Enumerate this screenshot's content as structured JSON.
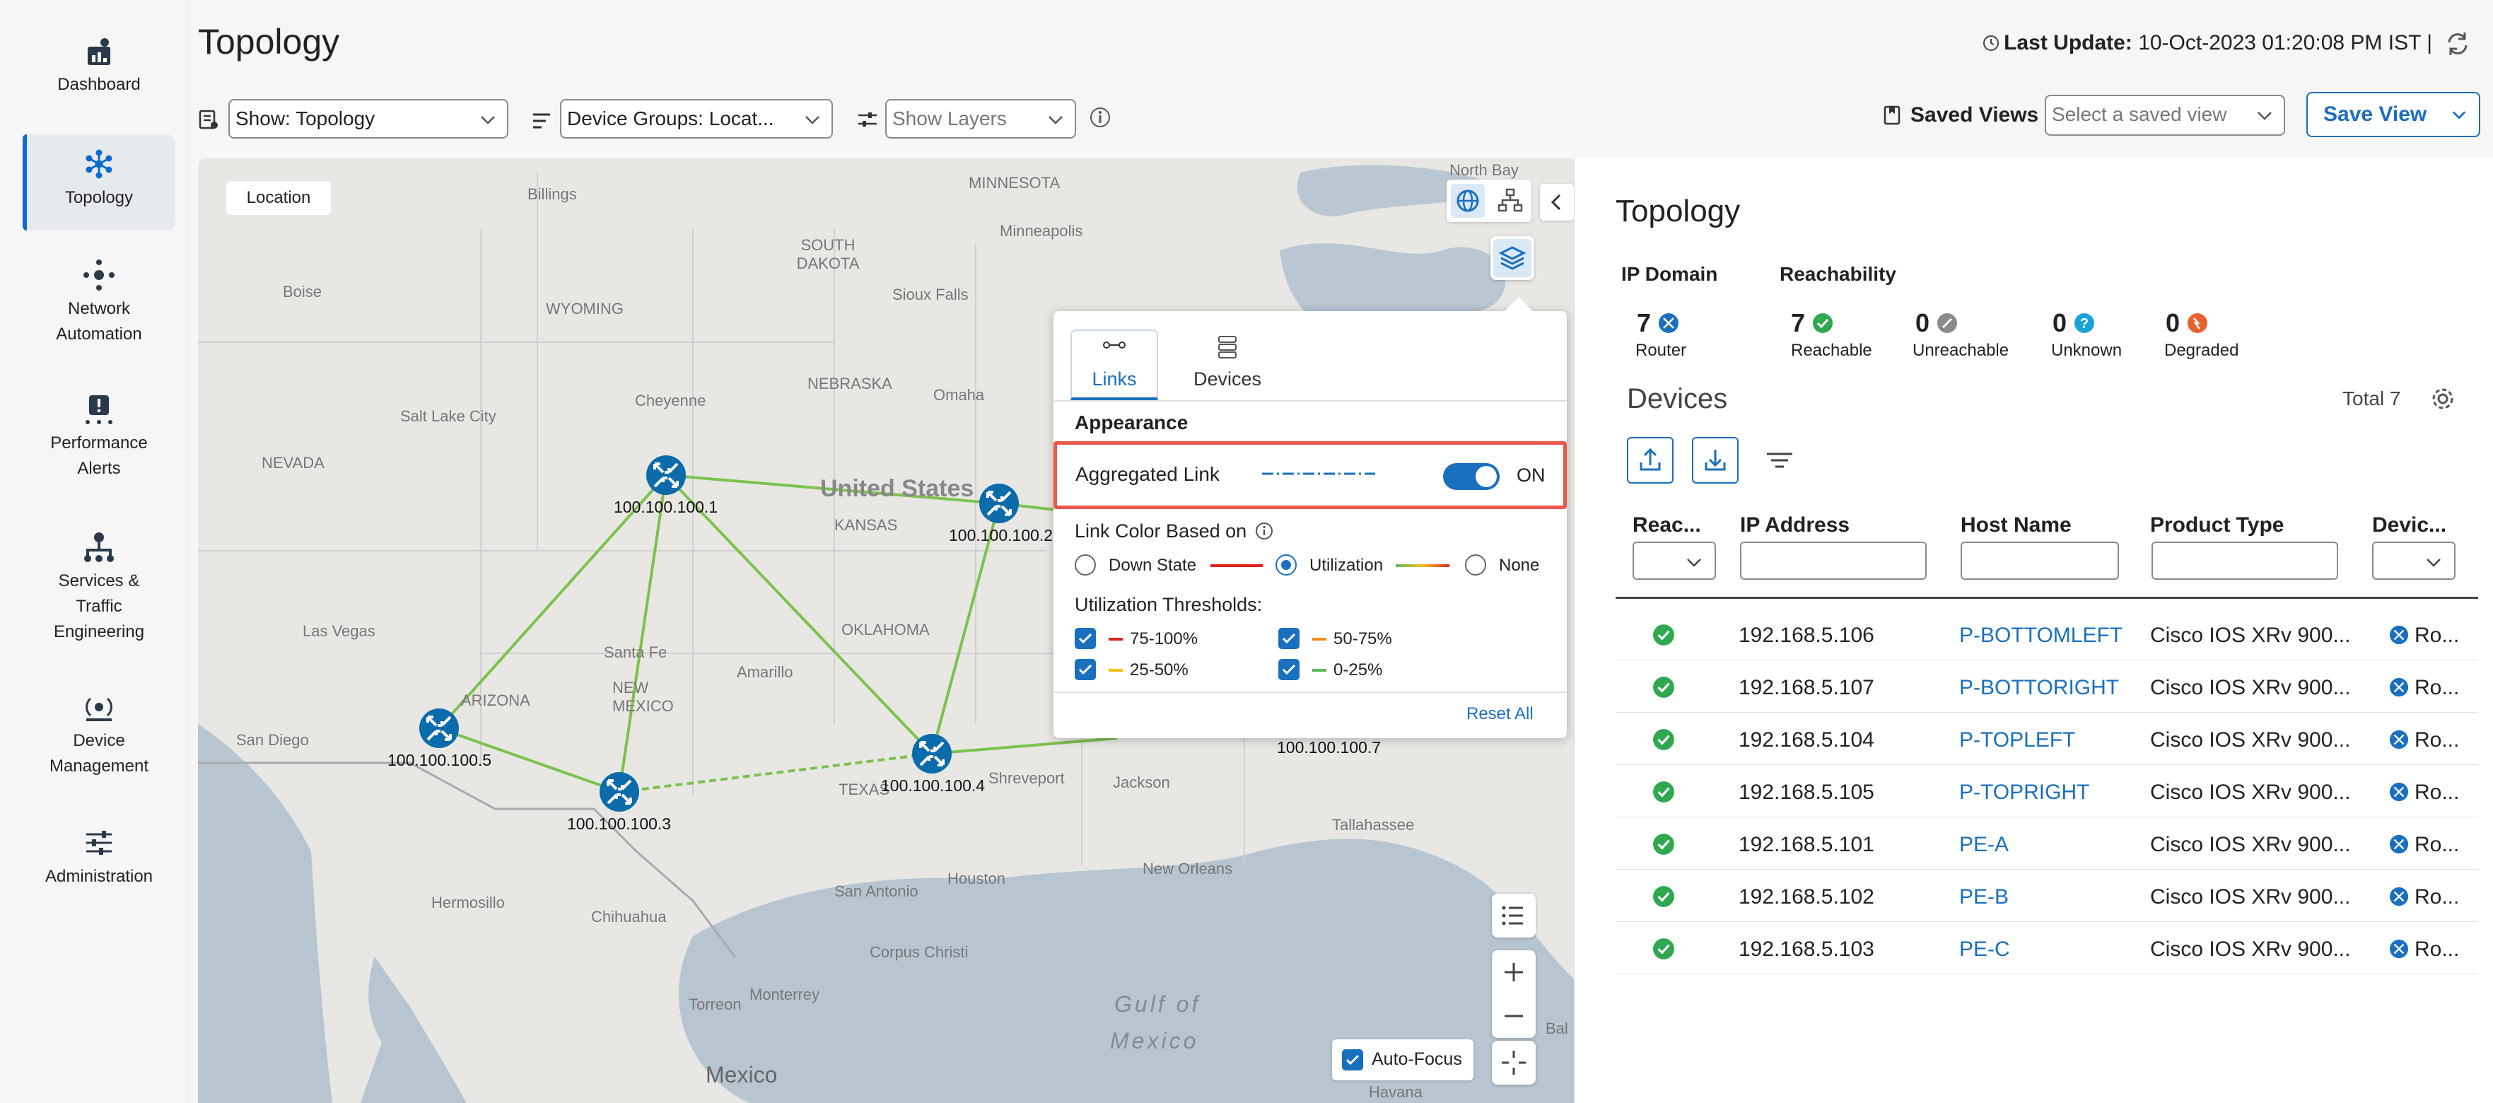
{
  "sidebar": {
    "items": [
      {
        "label": "Dashboard",
        "icon": "dashboard-icon"
      },
      {
        "label": "Topology",
        "icon": "topology-icon",
        "active": true
      },
      {
        "label_line1": "Network",
        "label_line2": "Automation",
        "icon": "network-automation-icon"
      },
      {
        "label_line1": "Performance",
        "label_line2": "Alerts",
        "icon": "performance-alerts-icon"
      },
      {
        "label_line1": "Services &",
        "label_line2": "Traffic",
        "label_line3": "Engineering",
        "icon": "services-icon"
      },
      {
        "label_line1": "Device",
        "label_line2": "Management",
        "icon": "device-management-icon"
      },
      {
        "label": "Administration",
        "icon": "administration-icon"
      }
    ]
  },
  "header": {
    "title": "Topology",
    "last_update_label": "Last Update:",
    "last_update_value": "10-Oct-2023 01:20:08 PM IST"
  },
  "toolbar": {
    "show_select": "Show: Topology",
    "device_groups_select": "Device Groups: Locat...",
    "show_layers_placeholder": "Show Layers",
    "saved_views_label": "Saved Views",
    "saved_view_placeholder": "Select a saved view",
    "save_view_button": "Save View"
  },
  "map": {
    "location_badge": "Location",
    "auto_focus_label": "Auto-Focus",
    "auto_focus_checked": true,
    "place_labels": [
      "North Bay",
      "Billings",
      "MINNESOTA",
      "Minneapolis",
      "SOUTH DAKOTA",
      "Boise",
      "WYOMING",
      "Sioux Falls",
      "NEBRASKA",
      "Omaha",
      "Cheyenne",
      "Salt Lake City",
      "NEVADA",
      "United States",
      "KANSAS",
      "OKLAHOMA",
      "Las Vegas",
      "ARIZONA",
      "Santa Fe",
      "NEW MEXICO",
      "Amarillo",
      "San Diego",
      "TEXAS",
      "Shreveport",
      "Jackson",
      "Tallahassee",
      "New Orleans",
      "San Antonio",
      "Houston",
      "Hermosillo",
      "Chihuahua",
      "Corpus Christi",
      "Torreon",
      "Gulf of",
      "Mexico",
      "Monterrey",
      "Mexico",
      "Havana",
      "Bal"
    ],
    "nodes": [
      {
        "label": "100.100.100.1"
      },
      {
        "label": "100.100.100.2"
      },
      {
        "label": "100.100.100.3"
      },
      {
        "label": "100.100.100.4"
      },
      {
        "label": "100.100.100.5"
      },
      {
        "label": "100.100.100.7"
      }
    ]
  },
  "layers_popover": {
    "tabs": [
      {
        "label": "Links",
        "icon": "links-icon",
        "active": true
      },
      {
        "label": "Devices",
        "icon": "devices-icon"
      }
    ],
    "appearance_heading": "Appearance",
    "aggregated_link_label": "Aggregated Link",
    "aggregated_link_state": "ON",
    "link_color_heading": "Link Color Based on",
    "link_color_options": [
      {
        "label": "Down State",
        "selected": false
      },
      {
        "label": "Utilization",
        "selected": true
      },
      {
        "label": "None",
        "selected": false
      }
    ],
    "thresholds_heading": "Utilization Thresholds:",
    "thresholds": [
      {
        "label": "75-100%",
        "color": "#e2231a",
        "checked": true
      },
      {
        "label": "50-75%",
        "color": "#f28a1e",
        "checked": true
      },
      {
        "label": "25-50%",
        "color": "#f2c21e",
        "checked": true
      },
      {
        "label": "0-25%",
        "color": "#5cb85c",
        "checked": true
      }
    ],
    "reset_all": "Reset All"
  },
  "panel": {
    "title": "Topology",
    "ip_domain_heading": "IP Domain",
    "reachability_heading": "Reachability",
    "ip_domain": {
      "count": "7",
      "label": "Router"
    },
    "reachability": [
      {
        "count": "7",
        "label": "Reachable",
        "color": "#2fa84f"
      },
      {
        "count": "0",
        "label": "Unreachable",
        "color": "#8a8a8a"
      },
      {
        "count": "0",
        "label": "Unknown",
        "color": "#1aa3d9"
      },
      {
        "count": "0",
        "label": "Degraded",
        "color": "#e8622d"
      }
    ],
    "devices_heading": "Devices",
    "total_label": "Total 7",
    "columns": [
      "Reac...",
      "IP Address",
      "Host Name",
      "Product Type",
      "Devic..."
    ],
    "rows": [
      {
        "ip": "192.168.5.106",
        "host": "P-BOTTOMLEFT",
        "product": "Cisco IOS XRv 900...",
        "device": "Ro..."
      },
      {
        "ip": "192.168.5.107",
        "host": "P-BOTTORIGHT",
        "product": "Cisco IOS XRv 900...",
        "device": "Ro..."
      },
      {
        "ip": "192.168.5.104",
        "host": "P-TOPLEFT",
        "product": "Cisco IOS XRv 900...",
        "device": "Ro..."
      },
      {
        "ip": "192.168.5.105",
        "host": "P-TOPRIGHT",
        "product": "Cisco IOS XRv 900...",
        "device": "Ro..."
      },
      {
        "ip": "192.168.5.101",
        "host": "PE-A",
        "product": "Cisco IOS XRv 900...",
        "device": "Ro..."
      },
      {
        "ip": "192.168.5.102",
        "host": "PE-B",
        "product": "Cisco IOS XRv 900...",
        "device": "Ro..."
      },
      {
        "ip": "192.168.5.103",
        "host": "PE-C",
        "product": "Cisco IOS XRv 900...",
        "device": "Ro..."
      }
    ]
  },
  "colors": {
    "accent": "#0b6bcb",
    "link_green": "#7cc24e",
    "highlight_red": "#e8584a",
    "node_blue": "#0b6bab"
  }
}
